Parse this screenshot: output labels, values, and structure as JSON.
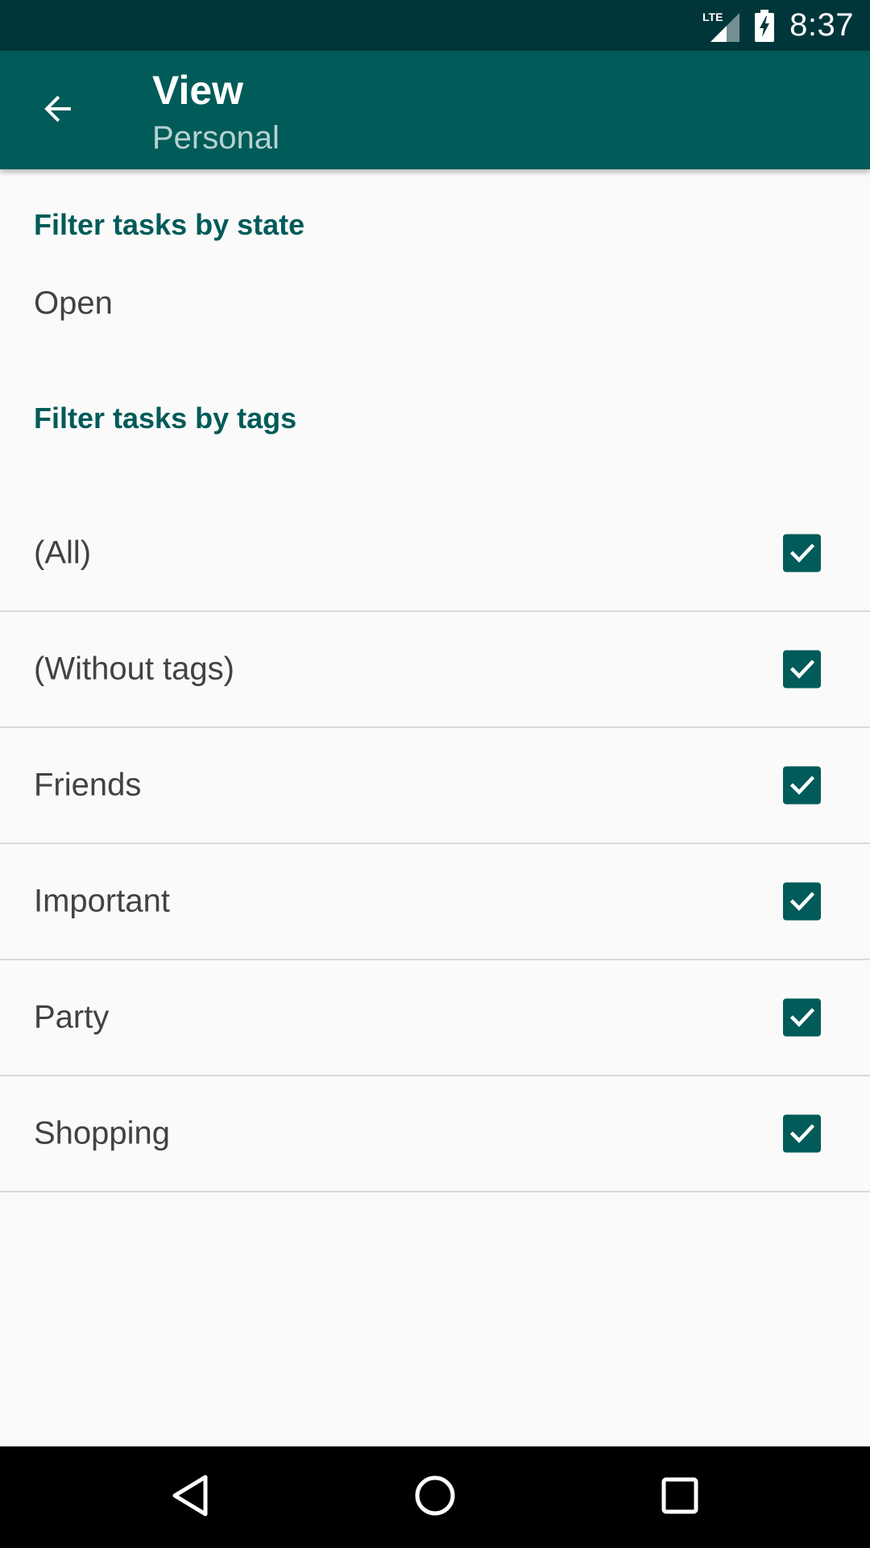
{
  "status_bar": {
    "time": "8:37",
    "network_label": "LTE",
    "icons": [
      "lte-signal-icon",
      "battery-charging-icon"
    ]
  },
  "app_bar": {
    "title": "View",
    "subtitle": "Personal",
    "back_icon": "arrow-back-icon"
  },
  "state_section": {
    "header": "Filter tasks by state",
    "value": "Open"
  },
  "tags_section": {
    "header": "Filter tasks by tags",
    "items": [
      {
        "label": "(All)",
        "checked": true
      },
      {
        "label": "(Without tags)",
        "checked": true
      },
      {
        "label": "Friends",
        "checked": true
      },
      {
        "label": "Important",
        "checked": true
      },
      {
        "label": "Party",
        "checked": true
      },
      {
        "label": "Shopping",
        "checked": true
      }
    ]
  },
  "nav_bar": {
    "icons": [
      "back-triangle-icon",
      "home-circle-icon",
      "recents-square-icon"
    ]
  },
  "colors": {
    "status_bar": "#00363a",
    "app_bar": "#005b59",
    "accent": "#005b59",
    "background": "#fafafa",
    "text": "#424242"
  }
}
